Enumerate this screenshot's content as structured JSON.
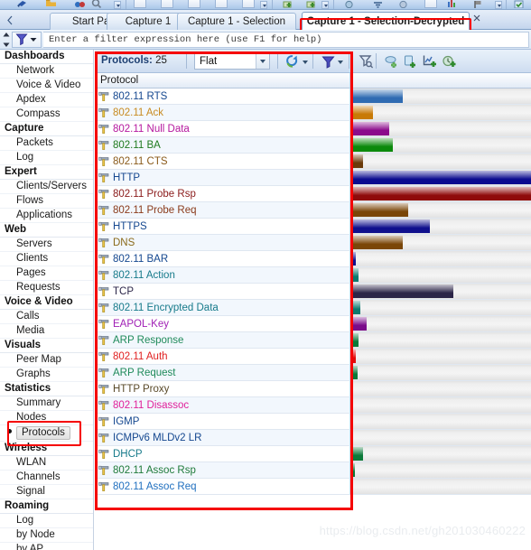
{
  "window": {
    "top_toolbar_icons": [
      "pointer-icon",
      "folder-icon",
      "binoculars-icon",
      "magnifier-icon",
      "dropdown-arrow-icon",
      "page-icon",
      "page-icon",
      "page-icon",
      "page-icon",
      "page-icon",
      "dropdown-arrow-icon",
      "green-plus-icon",
      "green-plus-icon",
      "dropdown-arrow-icon",
      "globe-icon",
      "filter-icon",
      "circle-icon",
      "table-icon",
      "chart-icon",
      "flag-icon",
      "dropdown-arrow-icon",
      "shield-icon"
    ]
  },
  "tabs": {
    "scroll_left_icon": "chevron-left-icon",
    "close_icon": "close-icon",
    "items": [
      {
        "label": "Start Page",
        "active": false
      },
      {
        "label": "Capture 1",
        "active": false
      },
      {
        "label": "Capture 1 - Selection",
        "active": false
      },
      {
        "label": "Capture 1 - Selection-Decrypted",
        "active": true
      }
    ]
  },
  "filter_bar": {
    "funnel_icon": "funnel-icon",
    "dropdown_icon": "chevron-down-icon",
    "spinner_icon": "spinner-up-down-icon",
    "placeholder": "Enter a filter expression here (use F1 for help)",
    "value": ""
  },
  "sidebar": {
    "groups": [
      {
        "label": "Dashboards",
        "items": [
          "Network",
          "Voice & Video",
          "Apdex",
          "Compass"
        ]
      },
      {
        "label": "Capture",
        "items": [
          "Packets",
          "Log"
        ]
      },
      {
        "label": "Expert",
        "items": [
          "Clients/Servers",
          "Flows",
          "Applications"
        ]
      },
      {
        "label": "Web",
        "items": [
          "Servers",
          "Clients",
          "Pages",
          "Requests"
        ]
      },
      {
        "label": "Voice & Video",
        "items": [
          "Calls",
          "Media"
        ]
      },
      {
        "label": "Visuals",
        "items": [
          "Peer Map",
          "Graphs"
        ]
      },
      {
        "label": "Statistics",
        "items": [
          "Summary",
          "Nodes",
          "Protocols"
        ]
      },
      {
        "label": "Wireless",
        "items": [
          "WLAN",
          "Channels",
          "Signal"
        ]
      },
      {
        "label": "Roaming",
        "items": [
          "Log",
          "by Node",
          "by AP"
        ]
      }
    ],
    "selected": "Protocols"
  },
  "protocol_panel": {
    "title_label": "Protocols:",
    "count": "25",
    "view_mode": {
      "value": "Flat",
      "dropdown_icon": "chevron-down-icon"
    },
    "toolbar_icons": [
      {
        "name": "refresh-icon",
        "has_dropdown": true
      },
      {
        "name": "filter-icon",
        "has_dropdown": true
      },
      {
        "name": "make-filter-icon",
        "has_dropdown": false
      },
      {
        "name": "insert-name-icon",
        "has_dropdown": false
      },
      {
        "name": "insert-node-icon",
        "has_dropdown": false
      },
      {
        "name": "add-graph-icon",
        "has_dropdown": false
      },
      {
        "name": "add-alarm-icon",
        "has_dropdown": false
      }
    ],
    "column_header": "Protocol",
    "row_icon": "protocol-hammer-icon"
  },
  "chart_data": {
    "type": "bar",
    "title": "Protocols",
    "xlabel": "",
    "ylabel": "Protocol",
    "xlim": [
      0,
      199
    ],
    "grid": false,
    "legend": "none",
    "categories": [
      "802.11 RTS",
      "802.11 Ack",
      "802.11 Null Data",
      "802.11 BA",
      "802.11 CTS",
      "HTTP",
      "802.11 Probe Rsp",
      "802.11 Probe Req",
      "HTTPS",
      "DNS",
      "802.11 BAR",
      "802.11 Action",
      "TCP",
      "802.11 Encrypted Data",
      "EAPOL-Key",
      "ARP Response",
      "802.11 Auth",
      "ARP Request",
      "HTTP Proxy",
      "802.11 Disassoc",
      "IGMP",
      "ICMPv6 MLDv2 LR",
      "DHCP",
      "802.11 Assoc Rsp",
      "802.11 Assoc Req"
    ],
    "values": [
      57,
      24,
      42,
      46,
      13,
      199,
      199,
      63,
      87,
      57,
      5,
      8,
      113,
      10,
      17,
      8,
      5,
      7,
      0,
      0,
      0,
      0,
      13,
      4,
      0
    ],
    "colors": [
      "#2f6bb2",
      "#c87a06",
      "#8b0a8b",
      "#0b8a0b",
      "#6b3a09",
      "#0b0b8f",
      "#8f0b0b",
      "#7a4608",
      "#10108d",
      "#7a4608",
      "#10108d",
      "#0b7a6e",
      "#2b2548",
      "#0b7a6e",
      "#7a0b8a",
      "#0b7a3a",
      "#e00b0b",
      "#0b7a3a",
      "#9a9a9a",
      "#9a9a9a",
      "#9a9a9a",
      "#9a9a9a",
      "#0b7a3a",
      "#0b7a3a",
      "#9a9a9a"
    ],
    "text_colors": [
      "#14478f",
      "#c88b20",
      "#b5179e",
      "#1f7a1f",
      "#8a5a1a",
      "#14478f",
      "#8a1a1a",
      "#8a3a1a",
      "#14478f",
      "#8a6a1a",
      "#14478f",
      "#167a8a",
      "#2b2548",
      "#167a8a",
      "#a01fb5",
      "#1f8a5a",
      "#e01f1f",
      "#1f8a5a",
      "#5a4a2a",
      "#e0209a",
      "#14478f",
      "#14478f",
      "#167a8a",
      "#1f7a3a",
      "#1f6fbf"
    ]
  },
  "watermark": "https://blog.csdn.net/gh201030460222"
}
